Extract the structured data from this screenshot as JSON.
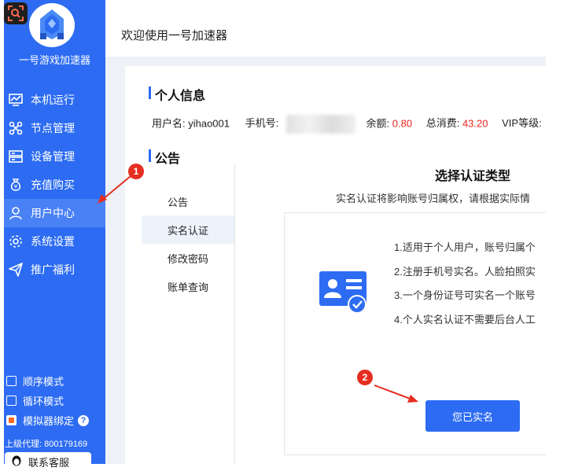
{
  "sidebar": {
    "app_name": "一号游戏加速器",
    "items": [
      {
        "label": "本机运行",
        "icon": "monitor-chart-icon"
      },
      {
        "label": "节点管理",
        "icon": "nodes-icon"
      },
      {
        "label": "设备管理",
        "icon": "server-icon"
      },
      {
        "label": "充值购买",
        "icon": "money-bag-icon"
      },
      {
        "label": "用户中心",
        "icon": "user-icon"
      },
      {
        "label": "系统设置",
        "icon": "gear-icon"
      },
      {
        "label": "推广福利",
        "icon": "send-icon"
      }
    ],
    "active_index": 4,
    "modes": [
      {
        "label": "顺序模式",
        "checked": false
      },
      {
        "label": "循环模式",
        "checked": false
      },
      {
        "label": "模拟器绑定",
        "checked": true
      }
    ],
    "agent_label": "上级代理: 800179169",
    "contact_label": "联系客服"
  },
  "header": {
    "welcome": "欢迎使用一号加速器"
  },
  "profile": {
    "title": "个人信息",
    "username_label": "用户名: yihao001",
    "phone_label": "手机号:",
    "balance_label": "余额:",
    "balance_value": "0.80",
    "spent_label": "总消费:",
    "spent_value": "43.20",
    "vip_label": "VIP等级:"
  },
  "notice": {
    "title": "公告"
  },
  "tabs": [
    "公告",
    "实名认证",
    "修改密码",
    "账单查询"
  ],
  "active_tab": 1,
  "verification": {
    "title": "选择认证类型",
    "description": "实名认证将影响账号归属权，请根据实际情",
    "lines": [
      "1.适用于个人用户，账号归属个",
      "2.注册手机号实名。人脸拍照实",
      "3.一个身份证号可实名一个账号",
      "4.个人实名认证不需要后台人工"
    ],
    "button_label": "您已实名"
  },
  "annotations": [
    "1",
    "2"
  ],
  "colors": {
    "primary": "#2d6cf2",
    "accent_red": "#e8251d",
    "annotation_red": "#e52e21"
  }
}
